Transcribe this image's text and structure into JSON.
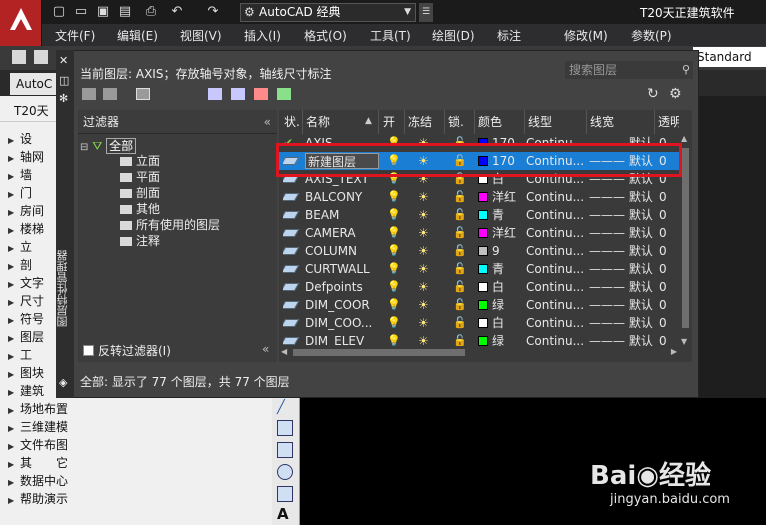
{
  "titlebar": {
    "workspace": "AutoCAD 经典",
    "app_title": "T20天正建筑软件"
  },
  "menu": [
    "文件(F)",
    "编辑(E)",
    "视图(V)",
    "插入(I)",
    "格式(O)",
    "工具(T)",
    "绘图(D)",
    "标注",
    "修改(M)",
    "参数(P)"
  ],
  "toolbar2": {
    "style_box": "Standard"
  },
  "tabs": {
    "active": "AutoC"
  },
  "left_panel": {
    "header": "T20天",
    "items": [
      "设",
      "轴网",
      "墙",
      "门",
      "房间",
      "楼梯",
      "立",
      "剖",
      "文字",
      "尺寸",
      "符号",
      "图层",
      "工",
      "图块",
      "建筑",
      "场地布置",
      "三维建模",
      "文件布图",
      "其　　它",
      "数据中心",
      "帮助演示"
    ]
  },
  "layer_manager": {
    "current_layer": "当前图层: AXIS；存放轴号对象，轴线尺寸标注",
    "search_placeholder": "搜索图层",
    "side_title": "图层特性管理器",
    "filters_title": "过滤器",
    "tree": {
      "root": "全部",
      "children": [
        "立面",
        "平面",
        "剖面",
        "其他",
        "所有使用的图层",
        "注释"
      ]
    },
    "invert_filter": "反转过滤器(I)",
    "columns": [
      "状.",
      "名称",
      "开",
      "冻结",
      "锁.",
      "颜色",
      "线型",
      "线宽",
      "透明"
    ],
    "rows": [
      {
        "name": "AXIS",
        "color_name": "170",
        "color": "#0000ff",
        "linetype": "Continu...",
        "lineweight": "默认",
        "transparency": "0",
        "state": "current"
      },
      {
        "name": "新建图层",
        "color_name": "170",
        "color": "#0000ff",
        "linetype": "Continu...",
        "lineweight": "默认",
        "transparency": "0",
        "state": "selected"
      },
      {
        "name": "AXIS_TEXT",
        "color_name": "白",
        "color": "#ffffff",
        "linetype": "Continu...",
        "lineweight": "默认",
        "transparency": "0",
        "state": ""
      },
      {
        "name": "BALCONY",
        "color_name": "洋红",
        "color": "#ff00ff",
        "linetype": "Continu...",
        "lineweight": "默认",
        "transparency": "0",
        "state": ""
      },
      {
        "name": "BEAM",
        "color_name": "青",
        "color": "#00ffff",
        "linetype": "Continu...",
        "lineweight": "默认",
        "transparency": "0",
        "state": ""
      },
      {
        "name": "CAMERA",
        "color_name": "洋红",
        "color": "#ff00ff",
        "linetype": "Continu...",
        "lineweight": "默认",
        "transparency": "0",
        "state": ""
      },
      {
        "name": "COLUMN",
        "color_name": "9",
        "color": "#c0c0c0",
        "linetype": "Continu...",
        "lineweight": "默认",
        "transparency": "0",
        "state": ""
      },
      {
        "name": "CURTWALL",
        "color_name": "青",
        "color": "#00ffff",
        "linetype": "Continu...",
        "lineweight": "默认",
        "transparency": "0",
        "state": ""
      },
      {
        "name": "Defpoints",
        "color_name": "白",
        "color": "#ffffff",
        "linetype": "Continu...",
        "lineweight": "默认",
        "transparency": "0",
        "state": ""
      },
      {
        "name": "DIM_COOR",
        "color_name": "绿",
        "color": "#00ff00",
        "linetype": "Continu...",
        "lineweight": "默认",
        "transparency": "0",
        "state": ""
      },
      {
        "name": "DIM_COO...",
        "color_name": "白",
        "color": "#ffffff",
        "linetype": "Continu...",
        "lineweight": "默认",
        "transparency": "0",
        "state": ""
      },
      {
        "name": "DIM_ELEV",
        "color_name": "绿",
        "color": "#00ff00",
        "linetype": "Continu...",
        "lineweight": "默认",
        "transparency": "0",
        "state": ""
      }
    ],
    "status": "全部: 显示了 77 个图层，共 77 个图层"
  },
  "watermark": {
    "brand": "Bai◉经验",
    "url": "jingyan.baidu.com"
  }
}
